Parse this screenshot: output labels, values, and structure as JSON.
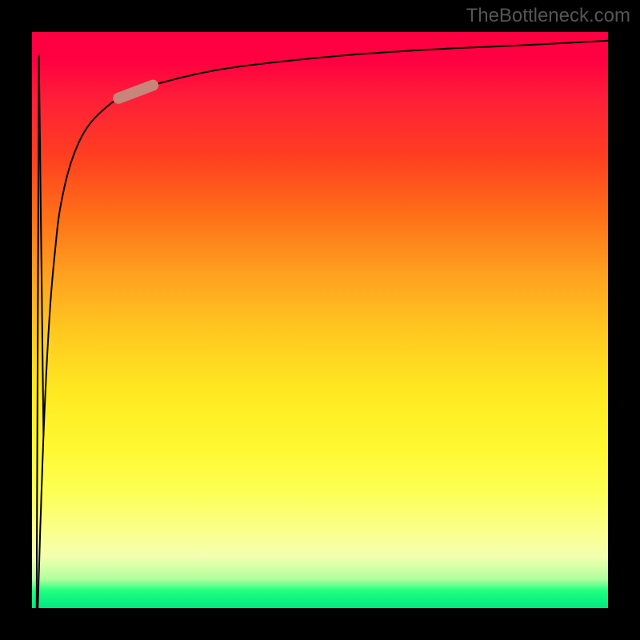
{
  "watermark": "TheBottleneck.com",
  "chart_data": {
    "type": "line",
    "title": "",
    "xlabel": "",
    "ylabel": "",
    "series": [
      {
        "name": "curve",
        "points": [
          {
            "x": 0.01,
            "y": 0.0
          },
          {
            "x": 0.012,
            "y": 0.96
          },
          {
            "x": 0.02,
            "y": 0.3
          },
          {
            "x": 0.03,
            "y": 0.5
          },
          {
            "x": 0.04,
            "y": 0.62
          },
          {
            "x": 0.05,
            "y": 0.7
          },
          {
            "x": 0.07,
            "y": 0.78
          },
          {
            "x": 0.1,
            "y": 0.84
          },
          {
            "x": 0.15,
            "y": 0.885
          },
          {
            "x": 0.2,
            "y": 0.905
          },
          {
            "x": 0.3,
            "y": 0.93
          },
          {
            "x": 0.4,
            "y": 0.945
          },
          {
            "x": 0.55,
            "y": 0.96
          },
          {
            "x": 0.7,
            "y": 0.97
          },
          {
            "x": 0.85,
            "y": 0.977
          },
          {
            "x": 1.0,
            "y": 0.985
          }
        ]
      }
    ],
    "marker": {
      "x_center": 0.18,
      "y_center": 0.9,
      "length": 0.06,
      "color": "#c8857a"
    },
    "gradient_stops": [
      {
        "pos": 0.0,
        "color": "#ff0040"
      },
      {
        "pos": 0.5,
        "color": "#ffc020"
      },
      {
        "pos": 0.8,
        "color": "#ffff40"
      },
      {
        "pos": 0.97,
        "color": "#20ff80"
      },
      {
        "pos": 1.0,
        "color": "#00e880"
      }
    ],
    "xlim": [
      0,
      1
    ],
    "ylim": [
      0,
      1
    ]
  }
}
